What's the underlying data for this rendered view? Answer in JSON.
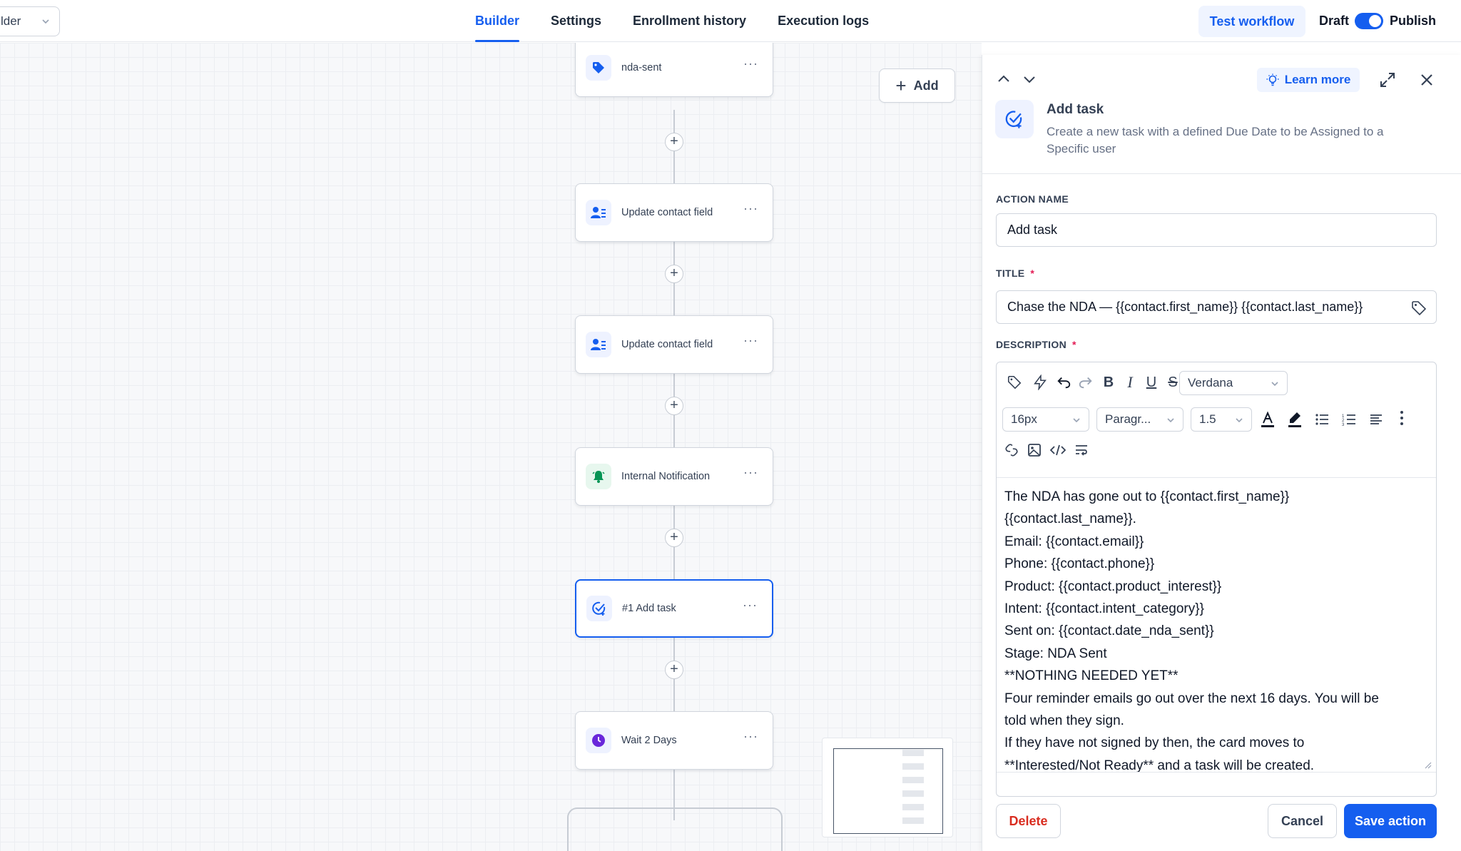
{
  "header": {
    "workflow_select": "lder",
    "tabs": [
      {
        "label": "Builder",
        "active": true
      },
      {
        "label": "Settings"
      },
      {
        "label": "Enrollment history"
      },
      {
        "label": "Execution logs"
      }
    ],
    "test_button": "Test workflow",
    "draft_label": "Draft",
    "publish_label": "Publish",
    "publish_toggle_on": true
  },
  "canvas": {
    "add_button": "Add",
    "nodes": [
      {
        "label": "nda-sent",
        "icon": "tag-icon"
      },
      {
        "label": "Update contact field",
        "icon": "contact-update-icon"
      },
      {
        "label": "Update contact field",
        "icon": "contact-update-icon"
      },
      {
        "label": "Internal Notification",
        "icon": "bell-icon"
      },
      {
        "label": "#1 Add task",
        "icon": "task-check-icon",
        "selected": true
      },
      {
        "label": "Wait 2 Days",
        "icon": "clock-icon"
      }
    ],
    "more_glyph": "···",
    "plus_glyph": "+"
  },
  "panel": {
    "learn_more": "Learn more",
    "title": "Add task",
    "description": "Create a new task with a defined Due Date to be Assigned to a Specific user",
    "action_name_label": "ACTION NAME",
    "action_name_value": "Add task",
    "title_label": "TITLE",
    "title_value": "Chase the NDA — {{contact.first_name}} {{contact.last_name}}",
    "description_label": "DESCRIPTION",
    "required_mark": "*",
    "toolbar": {
      "font_family": "Verdana",
      "font_size": "16px",
      "block_format": "Paragr...",
      "line_height": "1.5"
    },
    "body_lines": [
      "The NDA has gone out to {{contact.first_name}}",
      "{{contact.last_name}}.",
      "Email: {{contact.email}}",
      "Phone: {{contact.phone}}",
      "Product: {{contact.product_interest}}",
      "Intent: {{contact.intent_category}}",
      "Sent on: {{contact.date_nda_sent}}",
      "Stage: NDA Sent",
      "**NOTHING NEEDED YET**",
      "Four reminder emails go out over the next 16 days. You will be",
      "told when they sign.",
      "If they have not signed by then, the card moves to",
      "**Interested/Not Ready** and a task will be created."
    ],
    "delete_button": "Delete",
    "cancel_button": "Cancel",
    "save_button": "Save action"
  },
  "colors": {
    "accent": "#155eef",
    "danger": "#d92d20",
    "canvas_bg": "#f7f8fa"
  }
}
